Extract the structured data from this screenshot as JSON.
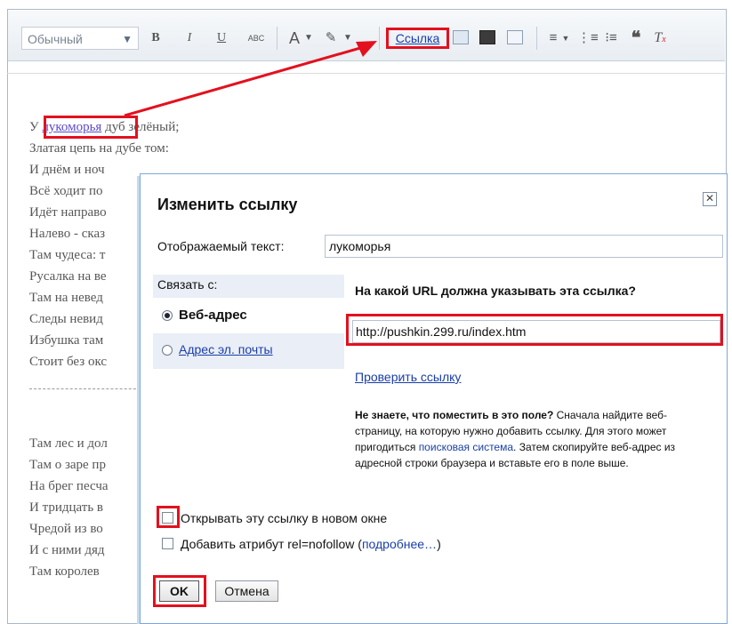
{
  "toolbar": {
    "style_select": "Обычный",
    "bold": "B",
    "italic": "I",
    "underline": "U",
    "strike": "ABC",
    "text_color": "A",
    "link_button": "Ссылка"
  },
  "editor": {
    "lines": [
      {
        "prefix": "У ",
        "link": "лукоморья",
        "suffix": " дуб зелёный;"
      },
      {
        "text": "Златая цепь на дубе том:"
      },
      {
        "text": "И днём и ноч"
      },
      {
        "text": "Всё ходит по"
      },
      {
        "text": "Идёт направо"
      },
      {
        "text": "Налево - сказ"
      },
      {
        "text": "Там чудеса: т"
      },
      {
        "text": "Русалка на ве"
      },
      {
        "text": "Там на невед"
      },
      {
        "text": "Следы невид"
      },
      {
        "text": "Избушка там"
      },
      {
        "text": "Стоит без окс"
      }
    ],
    "lines2": [
      "Там лес и дол",
      "Там о заре пр",
      "На брег песча",
      "И тридцать в",
      "Чредой из во",
      "И с ними дяд",
      "Там королев"
    ]
  },
  "dialog": {
    "title": "Изменить ссылку",
    "close": "✕",
    "display_text_label": "Отображаемый текст:",
    "display_text_value": "лукоморья",
    "link_to_label": "Связать с:",
    "option_web": "Веб-адрес",
    "option_email": "Адрес эл. почты",
    "url_question": "На какой URL должна указывать эта ссылка?",
    "url_value": "http://pushkin.299.ru/index.htm",
    "test_link": "Проверить ссылку",
    "help_bold": "Не знаете, что поместить в это поле?",
    "help_1": " Сначала найдите веб-страницу, на которую нужно добавить ссылку. Для этого может пригодиться ",
    "help_link": "поисковая система",
    "help_2": ". Затем скопируйте веб-адрес из адресной строки браузера и вставьте его в поле выше.",
    "open_new_window": "Открывать эту ссылку в новом окне",
    "nofollow_prefix": "Добавить атрибут rel=nofollow (",
    "nofollow_link": "подробнее…",
    "nofollow_suffix": ")",
    "ok": "OK",
    "cancel": "Отмена"
  }
}
